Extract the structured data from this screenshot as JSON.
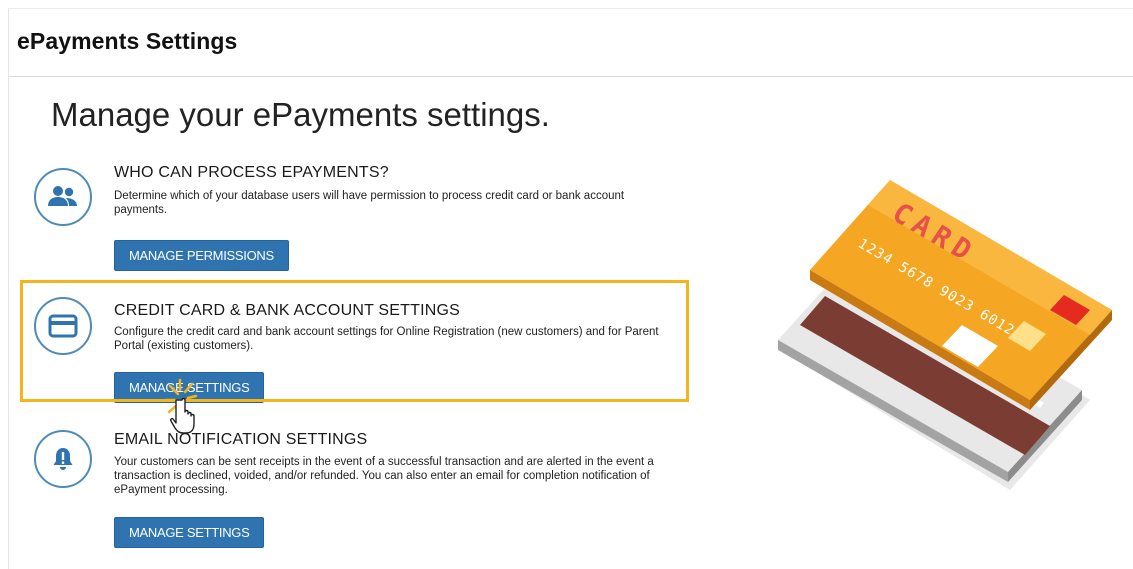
{
  "header": {
    "title": "ePayments Settings"
  },
  "main": {
    "title": "Manage your ePayments settings."
  },
  "sections": [
    {
      "heading": "WHO CAN PROCESS EPAYMENTS?",
      "description": "Determine which of your database users will have permission to process credit card or bank account payments.",
      "button": "MANAGE PERMISSIONS",
      "icon": "users-icon"
    },
    {
      "heading": "CREDIT CARD & BANK ACCOUNT SETTINGS",
      "description": "Configure the credit card and bank account settings for Online Registration (new customers) and for Parent Portal (existing customers).",
      "button": "MANAGE SETTINGS",
      "icon": "credit-card-icon"
    },
    {
      "heading": "EMAIL NOTIFICATION SETTINGS",
      "description": "Your customers can be sent receipts in the event of a successful transaction and are alerted in the event a transaction is declined, voided, and/or refunded. You can also enter an email for completion notification of ePayment processing.",
      "button": "MANAGE SETTINGS",
      "icon": "bell-icon"
    }
  ],
  "illustration": {
    "card_text": "CARD",
    "card_number": "1234 5678 9023 6012"
  },
  "colors": {
    "accent": "#2f74b0",
    "icon_ring": "#4f8bb8",
    "highlight": "#f3b51b",
    "card_orange": "#f5a623"
  }
}
